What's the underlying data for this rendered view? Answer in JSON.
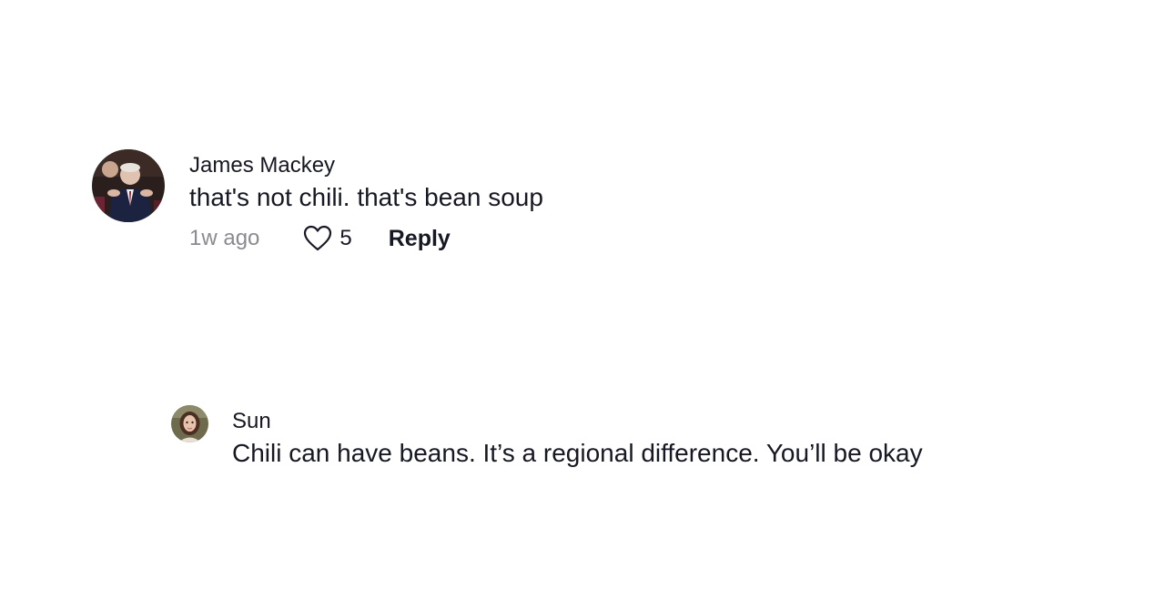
{
  "comments": [
    {
      "username": "James Mackey",
      "text": "that's not chili. that's bean soup",
      "timestamp": "1w ago",
      "likes": "5",
      "reply_label": "Reply",
      "avatar_icon": "user-avatar-photo"
    }
  ],
  "replies": [
    {
      "username": "Sun",
      "text": "Chili can have beans. It’s a regional difference. You’ll be okay",
      "avatar_icon": "user-avatar-photo"
    }
  ],
  "colors": {
    "text_primary": "#161823",
    "text_secondary": "#8a8b91",
    "background": "#ffffff"
  }
}
